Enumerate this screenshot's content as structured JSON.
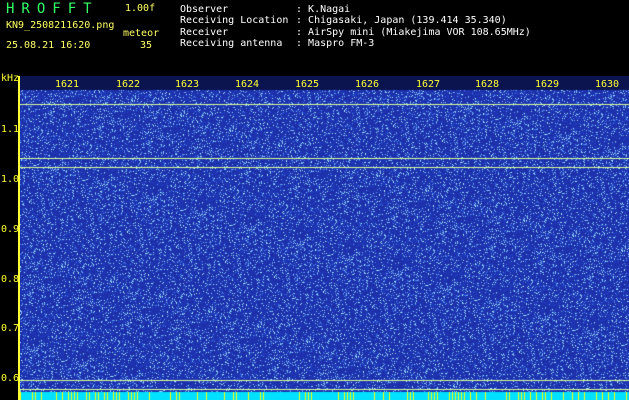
{
  "header": {
    "app_name": "HROFFT",
    "version": "1.00f",
    "filename": "KN9_2508211620.png",
    "datetime": "25.08.21 16:20",
    "meteor_label": "meteor",
    "meteor_count": "35",
    "meta": [
      {
        "key": "Observer",
        "value": "K.Nagai"
      },
      {
        "key": "Receiving Location",
        "value": "Chigasaki, Japan (139.414 35.340)"
      },
      {
        "key": "Receiver",
        "value": "AirSpy mini (Miakejima VOR 108.65MHz)"
      },
      {
        "key": "Receiving antenna",
        "value": "Maspro FM-3"
      }
    ]
  },
  "plot": {
    "y_unit": "kHz",
    "time_ticks": [
      "1621",
      "1622",
      "1623",
      "1624",
      "1625",
      "1626",
      "1627",
      "1628",
      "1629",
      "1630"
    ],
    "freq_ticks": [
      "1.1",
      "1.0",
      "0.9",
      "0.8",
      "0.7",
      "0.6"
    ],
    "freq_range_khz": [
      0.58,
      1.15
    ],
    "steady_carriers_khz": [
      1.1,
      1.005,
      0.99,
      0.615,
      0.6
    ],
    "colors": {
      "background": "#1d2fa8",
      "noise": "#7fb0ff",
      "carrier": "#d8ff9a",
      "axis": "#ffff33"
    }
  }
}
